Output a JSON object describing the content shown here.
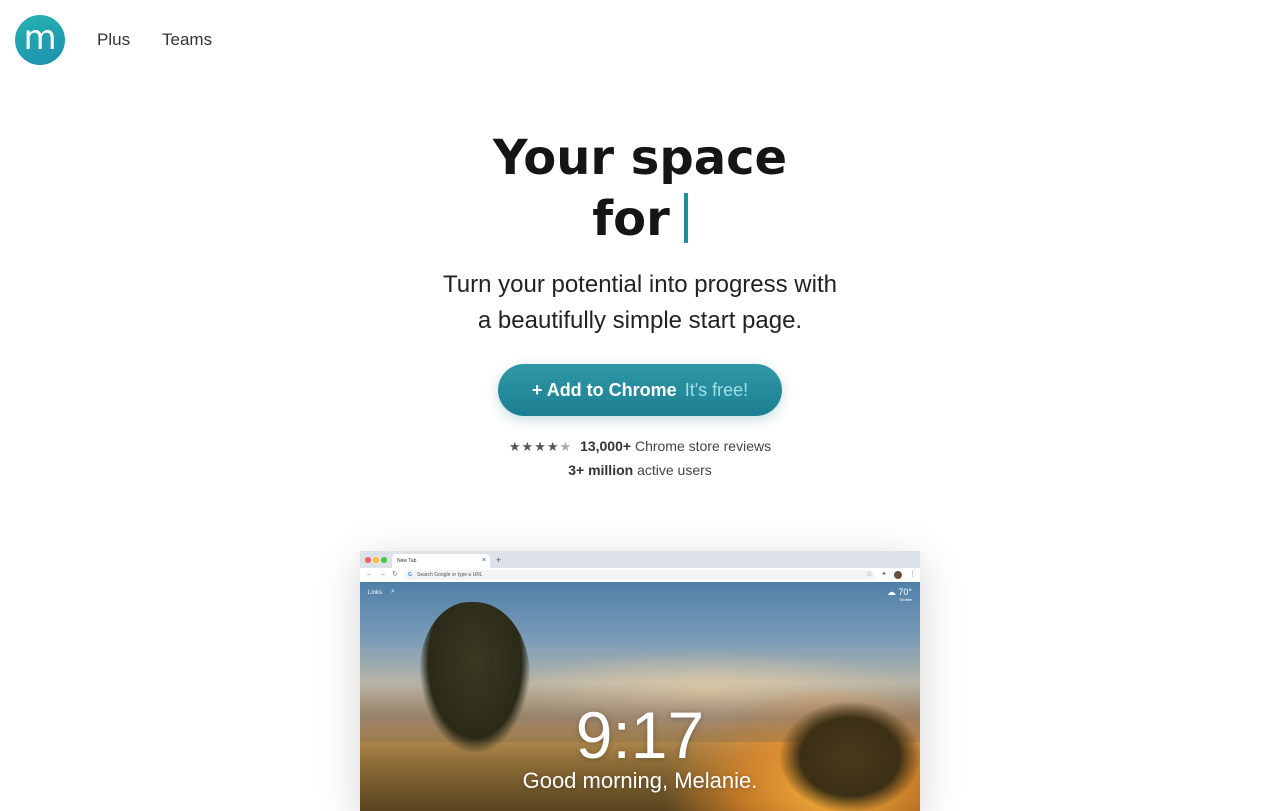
{
  "nav": {
    "logo_letter": "m",
    "links": [
      "Plus",
      "Teams"
    ]
  },
  "hero": {
    "title_line1": "Your space",
    "title_line2": "for",
    "subtitle_line1": "Turn your potential into progress with",
    "subtitle_line2": "a beautifully simple start page.",
    "cta_label": "+ Add to Chrome",
    "cta_free": "It's free!"
  },
  "social_proof": {
    "rating_stars": "★★★★",
    "rating_half": "★",
    "rating_value": 4.5,
    "reviews_count": "13,000+",
    "reviews_text": "Chrome store reviews",
    "users_count": "3+ million",
    "users_text": "active users"
  },
  "mockup": {
    "tab_title": "New Tab",
    "tab_close": "×",
    "new_tab": "+",
    "omnibox_placeholder": "Search Google or type a URL",
    "g_letter": "G",
    "links_label": "Links",
    "weather_temp": "70°",
    "weather_city": "Seattle",
    "clock": "9:17",
    "greeting": "Good morning, Melanie."
  },
  "colors": {
    "accent": "#1f8f9c",
    "logo_gradient_start": "#25b4b0",
    "logo_gradient_end": "#1e8fb0"
  }
}
